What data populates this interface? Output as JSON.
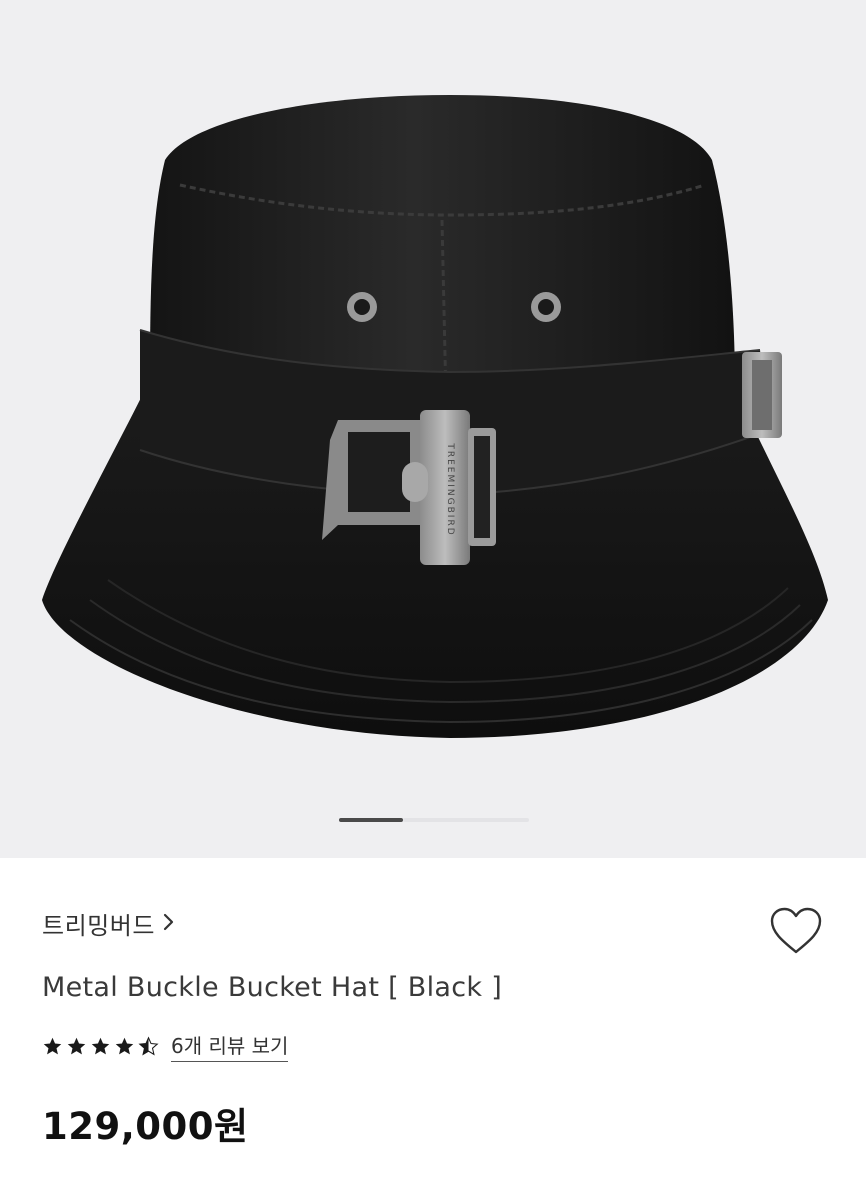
{
  "gallery": {
    "image_subject": "black bucket hat with metal buckle strap",
    "buckle_engraving": "TREEMINGBIRD",
    "pager": {
      "current": 1,
      "total": 3
    }
  },
  "product": {
    "brand": "트리밍버드",
    "title": "Metal Buckle Bucket Hat [ Black ]",
    "rating": 4.5,
    "review_link": "6개 리뷰 보기",
    "price": "129,000원"
  },
  "icons": {
    "brand_arrow": "chevron-right-icon",
    "wishlist": "heart-outline-icon",
    "rating": "star-icon"
  },
  "colors": {
    "gallery_bg": "#efeff1",
    "star": "#1a1a1a",
    "price": "#111111"
  }
}
